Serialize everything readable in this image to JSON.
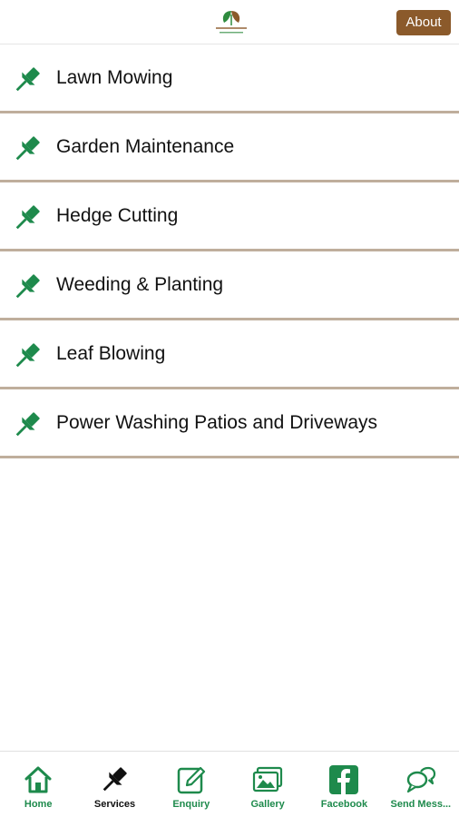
{
  "header": {
    "about_label": "About"
  },
  "colors": {
    "brand_green": "#1e8a4c",
    "brand_brown": "#8b5a2b",
    "divider": "#bfae9c"
  },
  "services": {
    "items": [
      {
        "label": "Lawn Mowing",
        "icon": "pin-icon"
      },
      {
        "label": "Garden Maintenance",
        "icon": "pin-icon"
      },
      {
        "label": "Hedge Cutting",
        "icon": "pin-icon"
      },
      {
        "label": "Weeding & Planting",
        "icon": "pin-icon"
      },
      {
        "label": "Leaf Blowing",
        "icon": "pin-icon"
      },
      {
        "label": "Power Washing Patios and Driveways",
        "icon": "pin-icon"
      }
    ]
  },
  "tabbar": {
    "tabs": [
      {
        "label": "Home",
        "icon": "home-icon",
        "active": false
      },
      {
        "label": "Services",
        "icon": "pin-icon",
        "active": true
      },
      {
        "label": "Enquiry",
        "icon": "edit-icon",
        "active": false
      },
      {
        "label": "Gallery",
        "icon": "gallery-icon",
        "active": false
      },
      {
        "label": "Facebook",
        "icon": "facebook-icon",
        "active": false
      },
      {
        "label": "Send Mess...",
        "icon": "chat-icon",
        "active": false
      }
    ]
  }
}
